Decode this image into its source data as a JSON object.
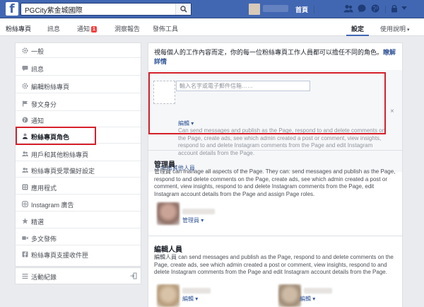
{
  "topbar": {
    "logo": "f",
    "search_value": "PGCity紫金城國際",
    "home_label": "首頁"
  },
  "pagebar": {
    "tabs": [
      {
        "label": "粉絲專頁"
      },
      {
        "label": "訊息"
      },
      {
        "label": "通知",
        "badge": "1"
      },
      {
        "label": "洞察報告"
      },
      {
        "label": "發佈工具"
      }
    ],
    "settings_label": "設定",
    "help_label": "使用說明"
  },
  "sidebar": {
    "items": [
      {
        "label": "一般",
        "icon": "gear-icon"
      },
      {
        "label": "訊息",
        "icon": "message-icon"
      },
      {
        "label": "編輯粉絲專頁",
        "icon": "gear-icon"
      },
      {
        "label": "發文身分",
        "icon": "flag-icon"
      },
      {
        "label": "通知",
        "icon": "globe-icon"
      },
      {
        "label": "粉絲專頁角色",
        "icon": "person-icon",
        "active": true
      },
      {
        "label": "用戶和其他粉絲專頁",
        "icon": "people-icon"
      },
      {
        "label": "粉絲專頁受眾偏好設定",
        "icon": "people-icon"
      },
      {
        "label": "應用程式",
        "icon": "apps-icon"
      },
      {
        "label": "Instagram 廣告",
        "icon": "instagram-icon"
      },
      {
        "label": "精選",
        "icon": "star-icon"
      },
      {
        "label": "多文發佈",
        "icon": "video-icon"
      },
      {
        "label": "粉絲專頁支援收件匣",
        "icon": "fb-icon"
      }
    ],
    "activity_log": {
      "label": "活動紀錄",
      "icon": "list-icon"
    }
  },
  "main": {
    "intro_text": "視每個人的工作內容而定，你的每一位粉絲專頁工作人員都可以擔任不同的角色。",
    "intro_link": "瞭解詳情",
    "add": {
      "placeholder": "輸入名字或電子郵件信箱……",
      "role_label": "編輯",
      "description": "Can send messages and publish as the Page, respond to and delete comments on the Page, create ads, see which admin created a post or comment, view insights, respond to and delete Instagram comments from the Page and edit Instagram account details from the Page.",
      "close": "×",
      "add_more": "+ 新增其他人員"
    },
    "admins": {
      "title": "管理員",
      "description": "管理員 can manage all aspects of the Page. They can: send messages and publish as the Page, respond to and delete comments on the Page, create ads, see which admin created a post or comment, view insights, respond to and delete Instagram comments from the Page, edit Instagram account details from the Page and assign Page roles.",
      "role_link": "管理員"
    },
    "editors": {
      "title": "編輯人員",
      "description": "編輯人員 can send messages and publish as the Page, respond to and delete comments on the Page, create ads, see which admin created a post or comment, view insights, respond to and delete Instagram comments from the Page and edit Instagram account details from the Page.",
      "role_link_1": "編輯",
      "role_link_2": "編輯"
    }
  },
  "colors": {
    "brand_blue": "#4267b2",
    "link_blue": "#365899",
    "highlight_red": "#d6202b",
    "badge_red": "#fa3e3e"
  }
}
